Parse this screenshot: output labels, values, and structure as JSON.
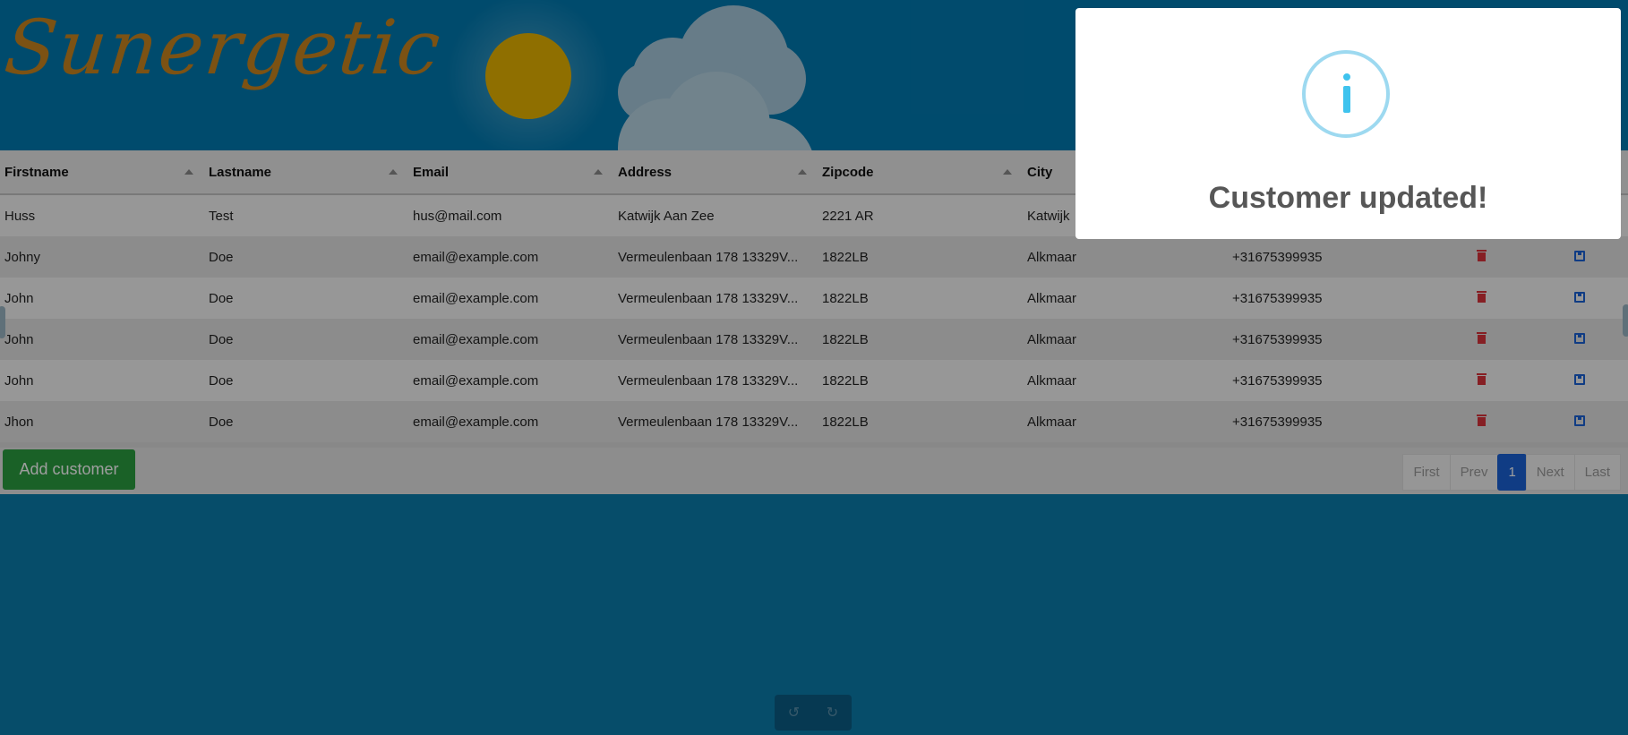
{
  "brand": {
    "logo": "Sunergetic"
  },
  "table": {
    "columns": [
      "Firstname",
      "Lastname",
      "Email",
      "Address",
      "Zipcode",
      "City"
    ],
    "rows": [
      {
        "firstname": "Huss",
        "lastname": "Test",
        "email": "hus@mail.com",
        "address": "Katwijk Aan Zee",
        "zipcode": "2221 AR",
        "city": "Katwijk",
        "phone": ""
      },
      {
        "firstname": "Johny",
        "lastname": "Doe",
        "email": "email@example.com",
        "address": "Vermeulenbaan 178 13329V...",
        "zipcode": "1822LB",
        "city": "Alkmaar",
        "phone": "+31675399935"
      },
      {
        "firstname": "John",
        "lastname": "Doe",
        "email": "email@example.com",
        "address": "Vermeulenbaan 178 13329V...",
        "zipcode": "1822LB",
        "city": "Alkmaar",
        "phone": "+31675399935"
      },
      {
        "firstname": "John",
        "lastname": "Doe",
        "email": "email@example.com",
        "address": "Vermeulenbaan 178 13329V...",
        "zipcode": "1822LB",
        "city": "Alkmaar",
        "phone": "+31675399935"
      },
      {
        "firstname": "John",
        "lastname": "Doe",
        "email": "email@example.com",
        "address": "Vermeulenbaan 178 13329V...",
        "zipcode": "1822LB",
        "city": "Alkmaar",
        "phone": "+31675399935"
      },
      {
        "firstname": "Jhon",
        "lastname": "Doe",
        "email": "email@example.com",
        "address": "Vermeulenbaan 178 13329V...",
        "zipcode": "1822LB",
        "city": "Alkmaar",
        "phone": "+31675399935"
      }
    ]
  },
  "actions": {
    "add_customer": "Add customer"
  },
  "pagination": {
    "first": "First",
    "prev": "Prev",
    "current": "1",
    "next": "Next",
    "last": "Last"
  },
  "modal": {
    "title": "Customer updated!",
    "icon": "info-icon"
  },
  "history": {
    "undo_icon": "undo-icon",
    "redo_icon": "redo-icon"
  },
  "colors": {
    "delete": "#d9323a",
    "save": "#1a62d6",
    "add": "#2a9d3f",
    "info": "#3fc3ee"
  }
}
